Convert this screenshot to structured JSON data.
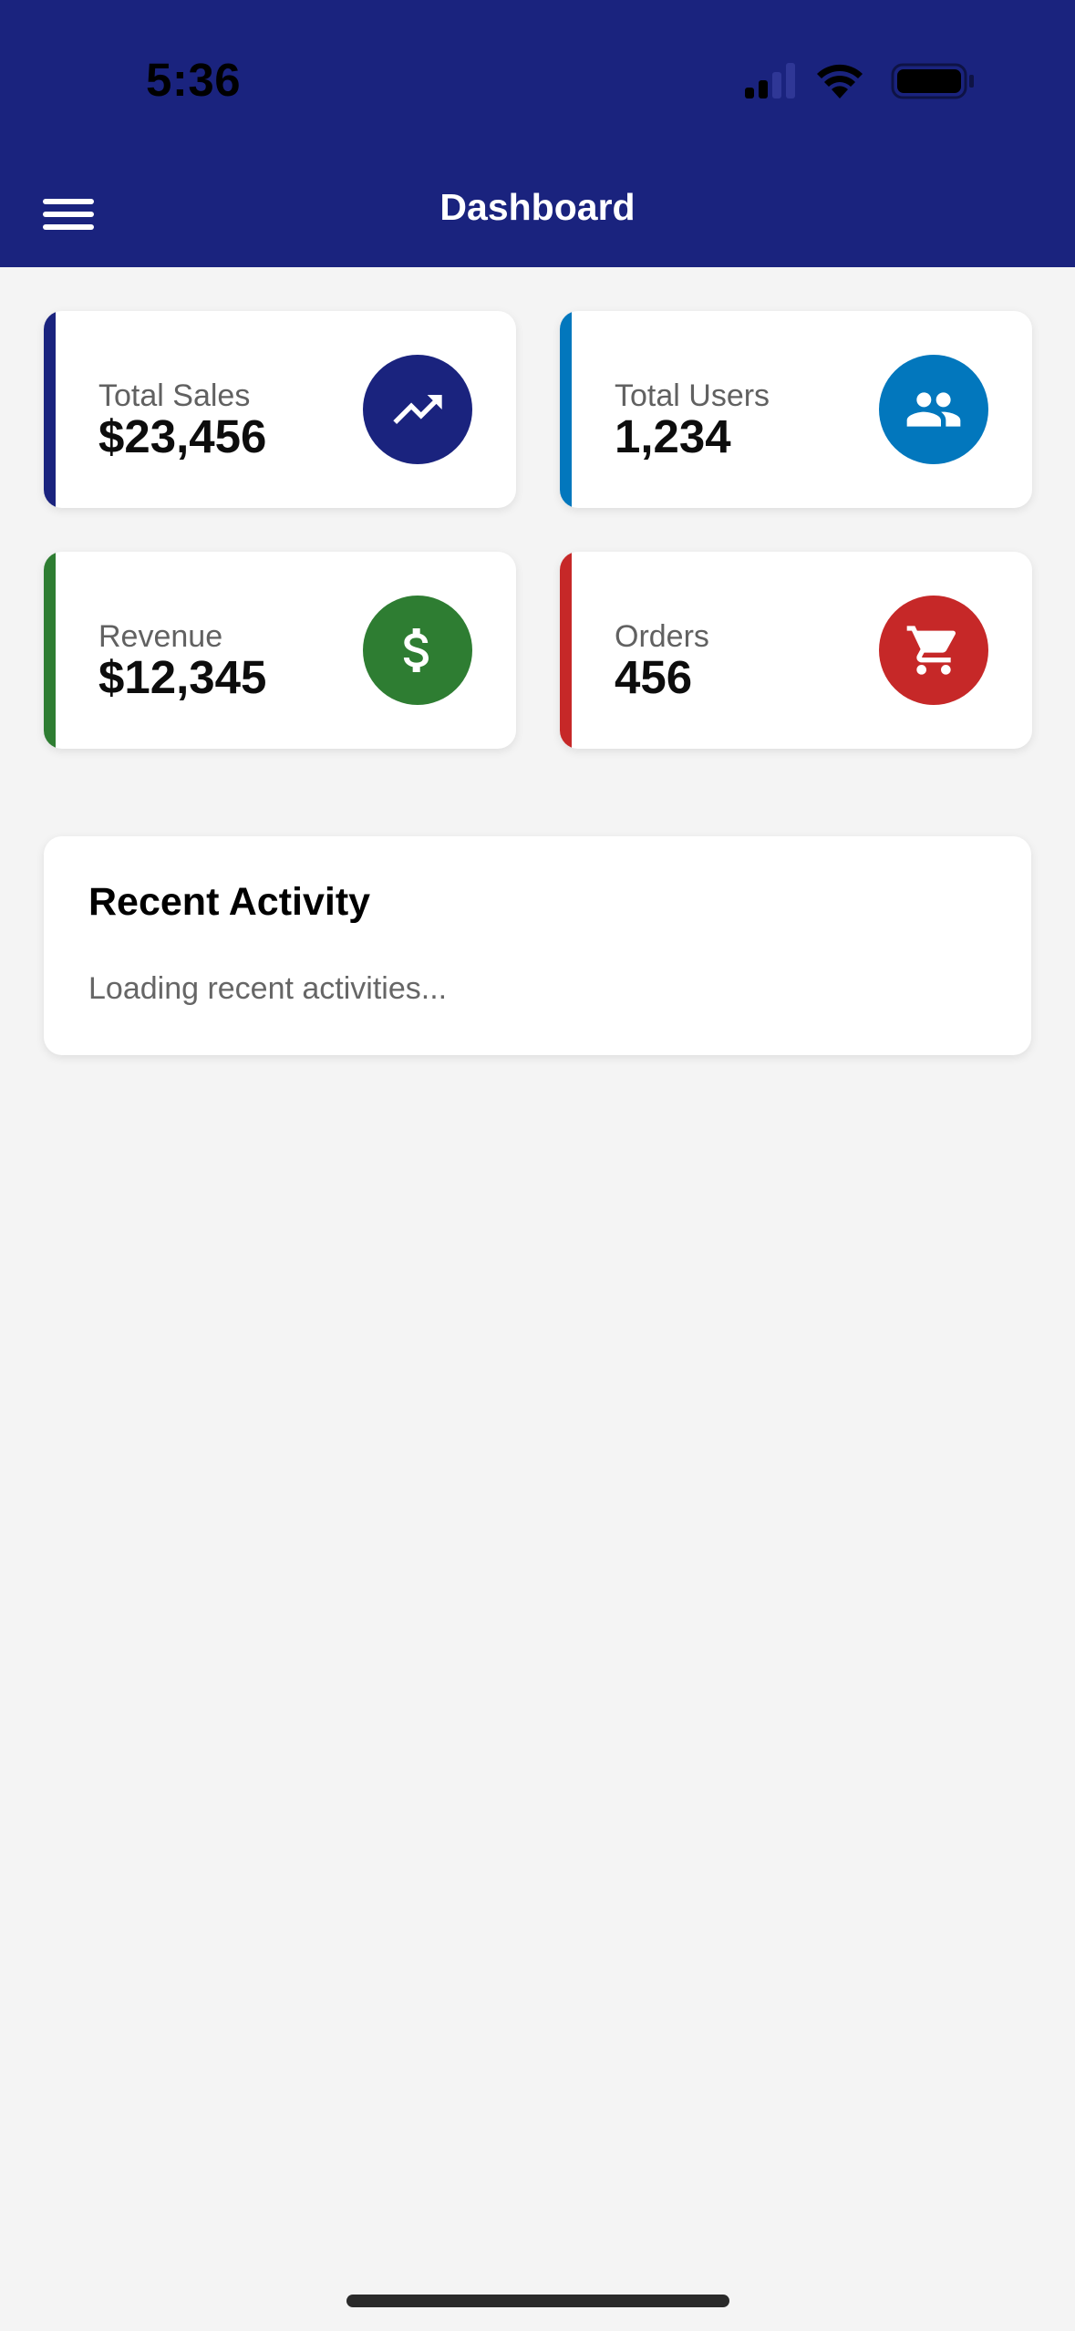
{
  "status_bar": {
    "time": "5:36"
  },
  "header": {
    "title": "Dashboard",
    "background": "#1a237e"
  },
  "stats": [
    {
      "label": "Total Sales",
      "value": "$23,456",
      "color": "#1a237e",
      "icon": "trending-up-icon"
    },
    {
      "label": "Total Users",
      "value": "1,234",
      "color": "#0277bd",
      "icon": "people-icon"
    },
    {
      "label": "Revenue",
      "value": "$12,345",
      "color": "#2e7d32",
      "icon": "dollar-icon"
    },
    {
      "label": "Orders",
      "value": "456",
      "color": "#c62828",
      "icon": "cart-icon"
    }
  ],
  "activity": {
    "title": "Recent Activity",
    "text": "Loading recent activities..."
  }
}
